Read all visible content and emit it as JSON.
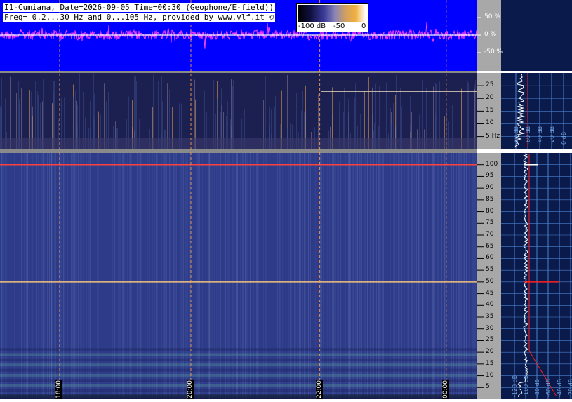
{
  "header": {
    "line1": "I1-Cumiana, Date=2026-09-05 Time=00:30 (Geophone/E-field))",
    "line2": "Freq= 0.2...30 Hz and 0...105 Hz, provided by www.vlf.it ©"
  },
  "colorbar": {
    "labels": [
      "-100 dB",
      "-50",
      "0"
    ]
  },
  "colors": {
    "waveform_bg": "#0000ff",
    "waveform": "#ff40ff",
    "spectro_low": "#1c2050",
    "spectro_mid": "#3b4d9e",
    "axis_panel": "#a8a8a8",
    "right_bg": "#0a1a4a",
    "profile_line": "#ffffff",
    "profile_red": "#ff2020",
    "marker_line": "#ffa050"
  },
  "chart_data": [
    {
      "type": "line",
      "panel": "waveform",
      "yticks": [
        "50 %",
        "0 %",
        "-50 %"
      ],
      "ytick_values": [
        50,
        0,
        -50
      ]
    },
    {
      "type": "heatmap",
      "panel": "spectrogram-low",
      "ylim": [
        0.2,
        30
      ],
      "yticks": [
        25,
        20,
        15,
        10,
        5
      ],
      "ytick_labels": [
        "25",
        "20",
        "15",
        "10",
        "5 Hz"
      ],
      "right_xticks": [
        "-80 dB",
        "-60 dB",
        "-40 dB",
        "-20 dB",
        "0 dB"
      ]
    },
    {
      "type": "heatmap",
      "panel": "spectrogram-high",
      "ylim": [
        0,
        105
      ],
      "yticks": [
        100,
        95,
        90,
        85,
        80,
        75,
        70,
        65,
        60,
        55,
        50,
        45,
        40,
        35,
        30,
        25,
        20,
        15,
        10,
        5
      ],
      "right_xticks": [
        "-120 dB",
        "-100 dB",
        "-80 dB",
        "-60 dB",
        "-40 dB",
        "-20 dB"
      ],
      "time_labels": [
        "18:00",
        "20:00",
        "22:00",
        "00:00"
      ],
      "time_positions": [
        0.125,
        0.4,
        0.67,
        0.935
      ],
      "lines_hz": [
        50,
        100
      ]
    }
  ]
}
